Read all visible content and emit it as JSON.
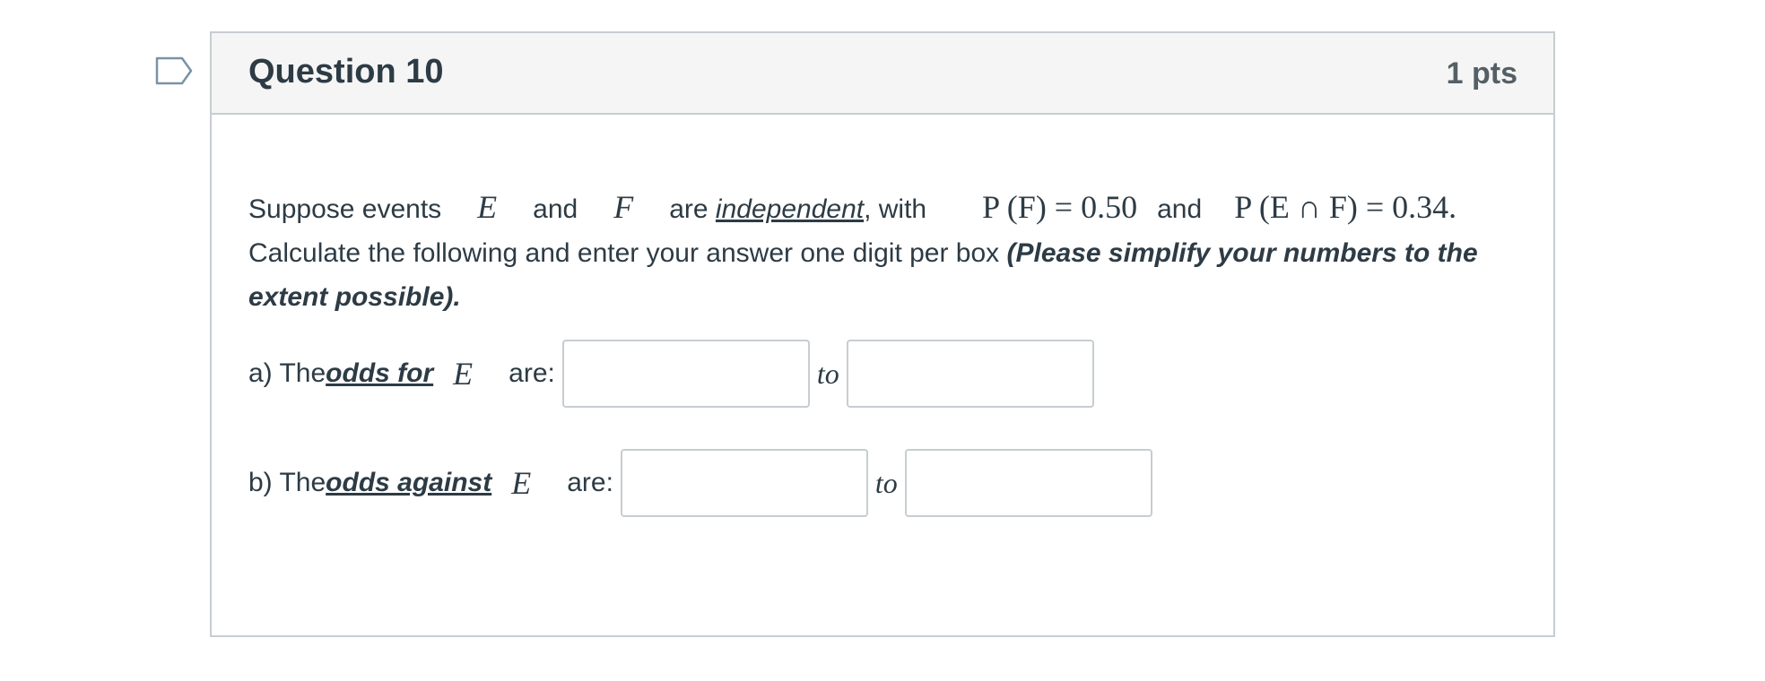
{
  "question": {
    "title": "Question 10",
    "points": "1 pts"
  },
  "prompt": {
    "p1": "Suppose events",
    "var_e": "E",
    "and1": "and",
    "var_f": "F",
    "are": "are ",
    "independent": "independent",
    "with": ", with",
    "prob_f": "P (F) = 0.50",
    "and2": "and",
    "prob_ef": "P (E ∩ F) = 0.34.",
    "p2": "Calculate the following and enter your answer one digit per box ",
    "instruction": "(Please simplify your numbers to the extent possible)."
  },
  "part_a": {
    "prefix": "a) The ",
    "odds": "odds for",
    "var": "E",
    "suffix": "are:",
    "to": "to",
    "input1_value": "",
    "input2_value": ""
  },
  "part_b": {
    "prefix": "b) The ",
    "odds": "odds against",
    "var": "E",
    "suffix": "are:",
    "to": "to",
    "input1_value": "",
    "input2_value": ""
  }
}
